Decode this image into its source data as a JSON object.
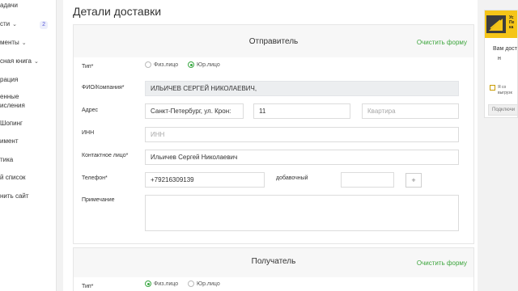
{
  "sidebar": {
    "items": [
      {
        "label": "адачи",
        "chevron": false
      },
      {
        "label": "сти",
        "chevron": true,
        "badge": "2"
      },
      {
        "label": "менты",
        "chevron": true
      },
      {
        "label": "сная книга",
        "chevron": true
      },
      {
        "label": "рация",
        "chevron": false
      },
      {
        "label": "енные",
        "chevron": false
      },
      {
        "label": "исления",
        "chevron": false
      },
      {
        "label": "Шопинг",
        "chevron": false
      },
      {
        "label": "имент",
        "chevron": false
      },
      {
        "label": "тика",
        "chevron": false
      },
      {
        "label": "й список",
        "chevron": false
      },
      {
        "label": "нить сайт",
        "chevron": false
      }
    ]
  },
  "page": {
    "title": "Детали доставки"
  },
  "sender": {
    "section_title": "Отправитель",
    "clear_label": "Очистить форму",
    "type_label": "Тип*",
    "type_options": {
      "individual": "Физ.лицо",
      "legal": "Юр.лицо"
    },
    "type_selected": "legal",
    "name_label": "ФИО/Компания*",
    "name_value": "ИЛЬИЧЕВ СЕРГЕЙ НИКОЛАЕВИЧ,",
    "address_label": "Адрес",
    "address_value": "Санкт-Петербург, ул. Крон:",
    "house_value": "11",
    "apartment_placeholder": "Квартира",
    "inn_label": "ИНН",
    "inn_placeholder": "ИНН",
    "contact_label": "Контактное лицо*",
    "contact_value": "Ильичев Сергей Николаевич",
    "phone_label": "Телефон*",
    "phone_value": "+79216309139",
    "extension_label": "добавочный",
    "extension_value": "",
    "add_label": "+",
    "note_label": "Примечание",
    "note_value": ""
  },
  "recipient": {
    "section_title": "Получатель",
    "clear_label": "Очистить форму",
    "type_label": "Тип*",
    "type_options": {
      "individual": "Физ.лицо",
      "legal": "Юр.лицо"
    },
    "type_selected": "individual"
  },
  "right_panel": {
    "head_text": "Ус\nПе\nка",
    "text1": "Вам дост",
    "text2": "н",
    "small1": "Я со",
    "small2": "выгрузк",
    "button_label": "Подключи"
  },
  "colors": {
    "accent_green": "#3aa843",
    "brand_yellow": "#f5c518"
  }
}
